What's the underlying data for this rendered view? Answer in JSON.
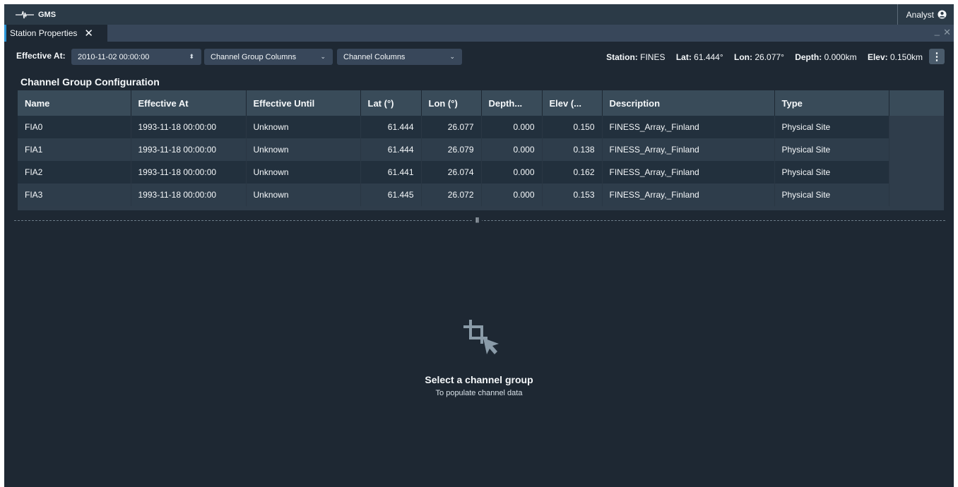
{
  "app": {
    "title": "GMS",
    "user": "Analyst"
  },
  "tab": {
    "label": "Station Properties"
  },
  "toolbar": {
    "effective_at_label": "Effective At:",
    "effective_at_value": "2010-11-02 00:00:00",
    "channel_group_columns": "Channel Group Columns",
    "channel_columns": "Channel Columns"
  },
  "station": {
    "station_label": "Station:",
    "station_value": "FINES",
    "lat_label": "Lat:",
    "lat_value": "61.444°",
    "lon_label": "Lon:",
    "lon_value": "26.077°",
    "depth_label": "Depth:",
    "depth_value": "0.000km",
    "elev_label": "Elev:",
    "elev_value": "0.150km"
  },
  "section_title": "Channel Group Configuration",
  "table": {
    "columns": [
      "Name",
      "Effective At",
      "Effective Until",
      "Lat (°)",
      "Lon (°)",
      "Depth...",
      "Elev (...",
      "Description",
      "Type"
    ],
    "rows": [
      [
        "FIA0",
        "1993-11-18 00:00:00",
        "Unknown",
        "61.444",
        "26.077",
        "0.000",
        "0.150",
        "FINESS_Array,_Finland",
        "Physical Site"
      ],
      [
        "FIA1",
        "1993-11-18 00:00:00",
        "Unknown",
        "61.444",
        "26.079",
        "0.000",
        "0.138",
        "FINESS_Array,_Finland",
        "Physical Site"
      ],
      [
        "FIA2",
        "1993-11-18 00:00:00",
        "Unknown",
        "61.441",
        "26.074",
        "0.000",
        "0.162",
        "FINESS_Array,_Finland",
        "Physical Site"
      ],
      [
        "FIA3",
        "1993-11-18 00:00:00",
        "Unknown",
        "61.445",
        "26.072",
        "0.000",
        "0.153",
        "FINESS_Array,_Finland",
        "Physical Site"
      ]
    ]
  },
  "empty_state": {
    "title": "Select a channel group",
    "subtitle": "To populate channel data"
  },
  "colors": {
    "background": "#1e2833",
    "header_bar": "#2b3a47",
    "accent": "#2b95d6",
    "table_header": "#394b59"
  }
}
